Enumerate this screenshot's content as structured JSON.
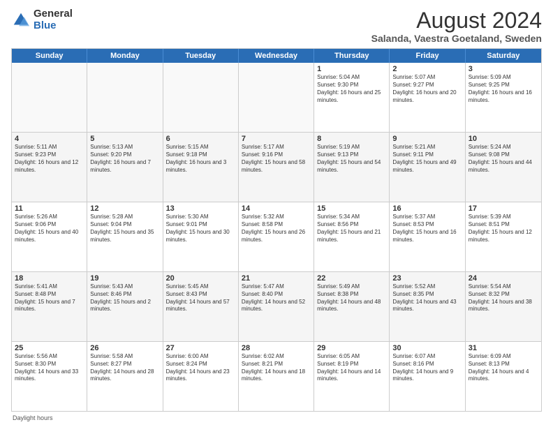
{
  "logo": {
    "general": "General",
    "blue": "Blue"
  },
  "title": "August 2024",
  "subtitle": "Salanda, Vaestra Goetaland, Sweden",
  "days": [
    "Sunday",
    "Monday",
    "Tuesday",
    "Wednesday",
    "Thursday",
    "Friday",
    "Saturday"
  ],
  "weeks": [
    [
      {
        "day": "",
        "text": ""
      },
      {
        "day": "",
        "text": ""
      },
      {
        "day": "",
        "text": ""
      },
      {
        "day": "",
        "text": ""
      },
      {
        "day": "1",
        "text": "Sunrise: 5:04 AM\nSunset: 9:30 PM\nDaylight: 16 hours and 25 minutes."
      },
      {
        "day": "2",
        "text": "Sunrise: 5:07 AM\nSunset: 9:27 PM\nDaylight: 16 hours and 20 minutes."
      },
      {
        "day": "3",
        "text": "Sunrise: 5:09 AM\nSunset: 9:25 PM\nDaylight: 16 hours and 16 minutes."
      }
    ],
    [
      {
        "day": "4",
        "text": "Sunrise: 5:11 AM\nSunset: 9:23 PM\nDaylight: 16 hours and 12 minutes."
      },
      {
        "day": "5",
        "text": "Sunrise: 5:13 AM\nSunset: 9:20 PM\nDaylight: 16 hours and 7 minutes."
      },
      {
        "day": "6",
        "text": "Sunrise: 5:15 AM\nSunset: 9:18 PM\nDaylight: 16 hours and 3 minutes."
      },
      {
        "day": "7",
        "text": "Sunrise: 5:17 AM\nSunset: 9:16 PM\nDaylight: 15 hours and 58 minutes."
      },
      {
        "day": "8",
        "text": "Sunrise: 5:19 AM\nSunset: 9:13 PM\nDaylight: 15 hours and 54 minutes."
      },
      {
        "day": "9",
        "text": "Sunrise: 5:21 AM\nSunset: 9:11 PM\nDaylight: 15 hours and 49 minutes."
      },
      {
        "day": "10",
        "text": "Sunrise: 5:24 AM\nSunset: 9:08 PM\nDaylight: 15 hours and 44 minutes."
      }
    ],
    [
      {
        "day": "11",
        "text": "Sunrise: 5:26 AM\nSunset: 9:06 PM\nDaylight: 15 hours and 40 minutes."
      },
      {
        "day": "12",
        "text": "Sunrise: 5:28 AM\nSunset: 9:04 PM\nDaylight: 15 hours and 35 minutes."
      },
      {
        "day": "13",
        "text": "Sunrise: 5:30 AM\nSunset: 9:01 PM\nDaylight: 15 hours and 30 minutes."
      },
      {
        "day": "14",
        "text": "Sunrise: 5:32 AM\nSunset: 8:58 PM\nDaylight: 15 hours and 26 minutes."
      },
      {
        "day": "15",
        "text": "Sunrise: 5:34 AM\nSunset: 8:56 PM\nDaylight: 15 hours and 21 minutes."
      },
      {
        "day": "16",
        "text": "Sunrise: 5:37 AM\nSunset: 8:53 PM\nDaylight: 15 hours and 16 minutes."
      },
      {
        "day": "17",
        "text": "Sunrise: 5:39 AM\nSunset: 8:51 PM\nDaylight: 15 hours and 12 minutes."
      }
    ],
    [
      {
        "day": "18",
        "text": "Sunrise: 5:41 AM\nSunset: 8:48 PM\nDaylight: 15 hours and 7 minutes."
      },
      {
        "day": "19",
        "text": "Sunrise: 5:43 AM\nSunset: 8:46 PM\nDaylight: 15 hours and 2 minutes."
      },
      {
        "day": "20",
        "text": "Sunrise: 5:45 AM\nSunset: 8:43 PM\nDaylight: 14 hours and 57 minutes."
      },
      {
        "day": "21",
        "text": "Sunrise: 5:47 AM\nSunset: 8:40 PM\nDaylight: 14 hours and 52 minutes."
      },
      {
        "day": "22",
        "text": "Sunrise: 5:49 AM\nSunset: 8:38 PM\nDaylight: 14 hours and 48 minutes."
      },
      {
        "day": "23",
        "text": "Sunrise: 5:52 AM\nSunset: 8:35 PM\nDaylight: 14 hours and 43 minutes."
      },
      {
        "day": "24",
        "text": "Sunrise: 5:54 AM\nSunset: 8:32 PM\nDaylight: 14 hours and 38 minutes."
      }
    ],
    [
      {
        "day": "25",
        "text": "Sunrise: 5:56 AM\nSunset: 8:30 PM\nDaylight: 14 hours and 33 minutes."
      },
      {
        "day": "26",
        "text": "Sunrise: 5:58 AM\nSunset: 8:27 PM\nDaylight: 14 hours and 28 minutes."
      },
      {
        "day": "27",
        "text": "Sunrise: 6:00 AM\nSunset: 8:24 PM\nDaylight: 14 hours and 23 minutes."
      },
      {
        "day": "28",
        "text": "Sunrise: 6:02 AM\nSunset: 8:21 PM\nDaylight: 14 hours and 18 minutes."
      },
      {
        "day": "29",
        "text": "Sunrise: 6:05 AM\nSunset: 8:19 PM\nDaylight: 14 hours and 14 minutes."
      },
      {
        "day": "30",
        "text": "Sunrise: 6:07 AM\nSunset: 8:16 PM\nDaylight: 14 hours and 9 minutes."
      },
      {
        "day": "31",
        "text": "Sunrise: 6:09 AM\nSunset: 8:13 PM\nDaylight: 14 hours and 4 minutes."
      }
    ]
  ],
  "footer": "Daylight hours"
}
